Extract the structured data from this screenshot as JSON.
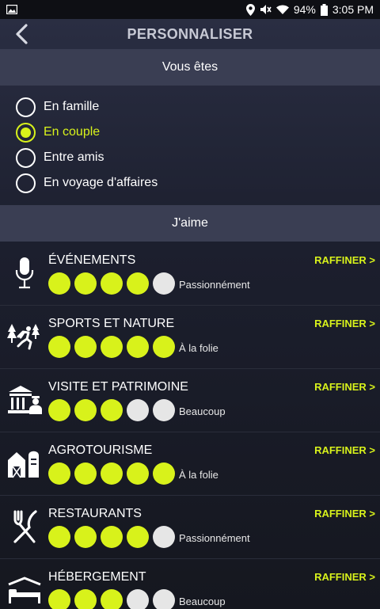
{
  "status_bar": {
    "battery": "94%",
    "time": "3:05 PM"
  },
  "header": {
    "title": "PERSONNALISER"
  },
  "profile_section": {
    "title": "Vous êtes",
    "options": [
      {
        "label": "En famille",
        "selected": false
      },
      {
        "label": "En couple",
        "selected": true
      },
      {
        "label": "Entre amis",
        "selected": false
      },
      {
        "label": "En voyage d'affaires",
        "selected": false
      }
    ]
  },
  "likes_section": {
    "title": "J'aime",
    "refine_label": "RAFFINER >",
    "categories": [
      {
        "icon": "microphone-icon",
        "title": "ÉVÉNEMENTS",
        "rating": 4,
        "max": 5,
        "level": "Passionnément"
      },
      {
        "icon": "sports-nature-icon",
        "title": "SPORTS ET NATURE",
        "rating": 5,
        "max": 5,
        "level": "À la folie"
      },
      {
        "icon": "heritage-icon",
        "title": "VISITE ET PATRIMOINE",
        "rating": 3,
        "max": 5,
        "level": "Beaucoup"
      },
      {
        "icon": "barn-icon",
        "title": "AGROTOURISME",
        "rating": 5,
        "max": 5,
        "level": "À la folie"
      },
      {
        "icon": "fork-knife-icon",
        "title": "RESTAURANTS",
        "rating": 4,
        "max": 5,
        "level": "Passionnément"
      },
      {
        "icon": "bed-icon",
        "title": "HÉBERGEMENT",
        "rating": 3,
        "max": 5,
        "level": "Beaucoup"
      }
    ]
  },
  "colors": {
    "accent": "#d8f21b",
    "section_bar": "#3a3e53",
    "dot_off": "#e6e6e6"
  }
}
